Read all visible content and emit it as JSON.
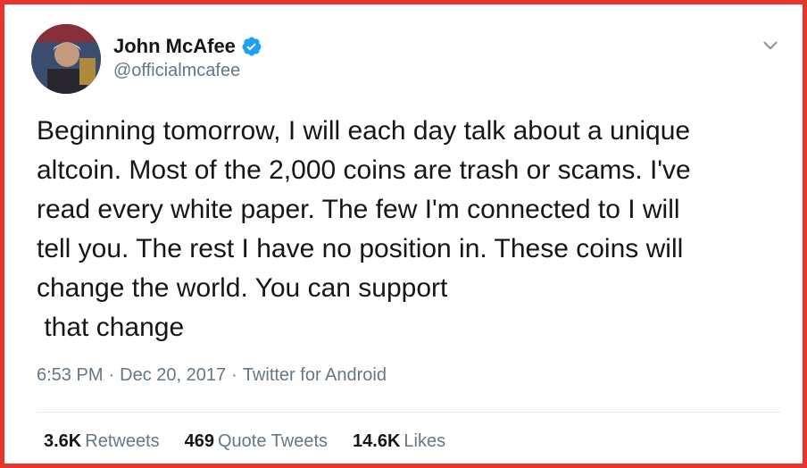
{
  "user": {
    "name": "John McAfee",
    "handle": "@officialmcafee",
    "verified": true
  },
  "tweet": {
    "text": "Beginning tomorrow, I will each day talk about a unique\naltcoin. Most of the 2,000 coins are trash or scams. I've\nread every white paper. The few I'm connected to I will\ntell you. The rest I have no position in. These coins will\nchange the world. You can support\n that change",
    "time": "6:53 PM",
    "date": "Dec 20, 2017",
    "source": "Twitter for Android",
    "separator": "·"
  },
  "stats": {
    "retweets_count": "3.6K",
    "retweets_label": "Retweets",
    "quotes_count": "469",
    "quotes_label": "Quote Tweets",
    "likes_count": "14.6K",
    "likes_label": "Likes"
  },
  "icons": {
    "verified": "verified-badge-icon",
    "menu": "chevron-down-icon"
  },
  "colors": {
    "frame_border": "#e8352b",
    "verified": "#1da1f2",
    "text_primary": "#14171a",
    "text_secondary": "#657786"
  }
}
